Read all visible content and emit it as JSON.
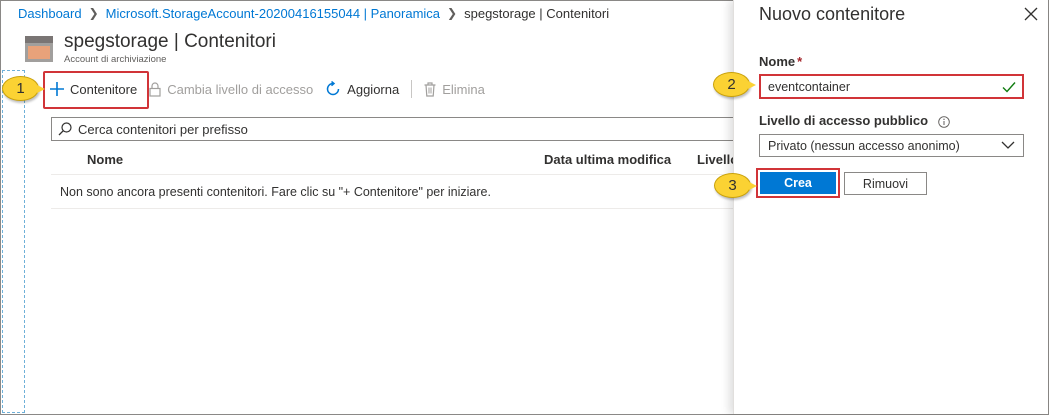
{
  "breadcrumb": {
    "items": [
      "Dashboard",
      "Microsoft.StorageAccount-20200416155044 | Panoramica"
    ],
    "current": "spegstorage | Contenitori"
  },
  "header": {
    "title": "spegstorage | Contenitori",
    "subtitle": "Account di archiviazione",
    "icon": "storage-account-icon"
  },
  "toolbar": {
    "add_label": "Contenitore",
    "access_label": "Cambia livello di accesso",
    "refresh_label": "Aggiorna",
    "delete_label": "Elimina"
  },
  "search": {
    "placeholder": "Cerca contenitori per prefisso"
  },
  "table": {
    "columns": [
      "Nome",
      "Data ultima modifica",
      "Livello"
    ],
    "empty_message": "Non sono ancora presenti contenitori. Fare clic su \"+ Contenitore\" per iniziare."
  },
  "panel": {
    "title": "Nuovo contenitore",
    "name_label": "Nome",
    "required_marker": "*",
    "name_value": "eventcontainer",
    "access_label": "Livello di accesso pubblico",
    "access_selected": "Privato (nessun accesso anonimo)",
    "create_label": "Crea",
    "discard_label": "Rimuovi"
  },
  "steps": [
    "1",
    "2",
    "3"
  ],
  "colors": {
    "accent": "#0078d4",
    "highlight": "#d13438",
    "callout": "#fbd233",
    "valid": "#107c10"
  }
}
